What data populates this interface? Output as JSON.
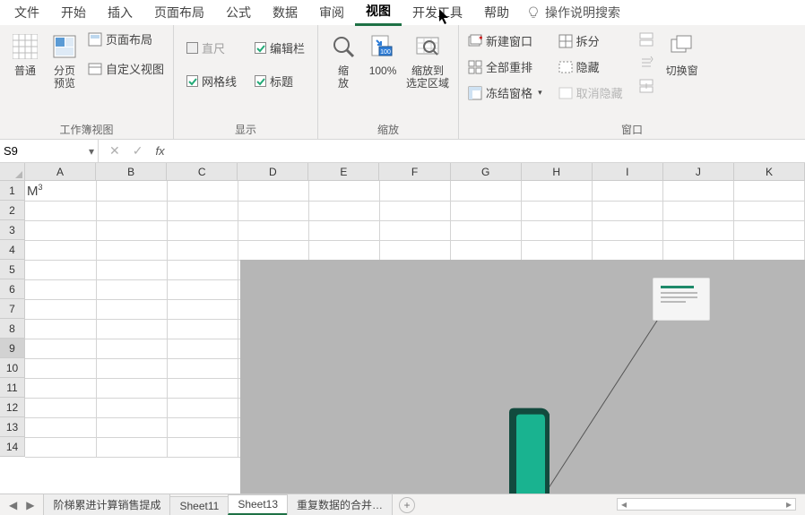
{
  "menu": {
    "items": [
      "文件",
      "开始",
      "插入",
      "页面布局",
      "公式",
      "数据",
      "审阅",
      "视图",
      "开发工具",
      "帮助"
    ],
    "active_index": 7,
    "search_label": "操作说明搜索"
  },
  "ribbon": {
    "views": {
      "normal": "普通",
      "page_break": "分页\n预览",
      "page_layout": "页面布局",
      "custom_view": "自定义视图",
      "group_label": "工作簿视图"
    },
    "show": {
      "ruler": {
        "label": "直尺",
        "checked": false,
        "disabled": true
      },
      "formula_bar": {
        "label": "编辑栏",
        "checked": true
      },
      "gridlines": {
        "label": "网格线",
        "checked": true
      },
      "headings": {
        "label": "标题",
        "checked": true
      },
      "group_label": "显示"
    },
    "zoom": {
      "zoom": "缩\n放",
      "hundred": "100%",
      "to_selection": "缩放到\n选定区域",
      "group_label": "缩放"
    },
    "window": {
      "new_window": "新建窗口",
      "arrange_all": "全部重排",
      "freeze_panes": "冻结窗格",
      "split": "拆分",
      "hide": "隐藏",
      "unhide": "取消隐藏",
      "switch_windows": "切换窗",
      "group_label": "窗口"
    }
  },
  "name_box": "S9",
  "columns": [
    "A",
    "B",
    "C",
    "D",
    "E",
    "F",
    "G",
    "H",
    "I",
    "J",
    "K"
  ],
  "rows": [
    "1",
    "2",
    "3",
    "4",
    "5",
    "6",
    "7",
    "8",
    "9",
    "10",
    "11",
    "12",
    "13",
    "14"
  ],
  "selected_row_index": 8,
  "cell_A1": {
    "base": "M",
    "sup": "3"
  },
  "sheets": {
    "tabs": [
      "阶梯累进计算销售提成",
      "Sheet11",
      "Sheet13",
      "重复数据的合并…"
    ],
    "active_index": 2
  }
}
